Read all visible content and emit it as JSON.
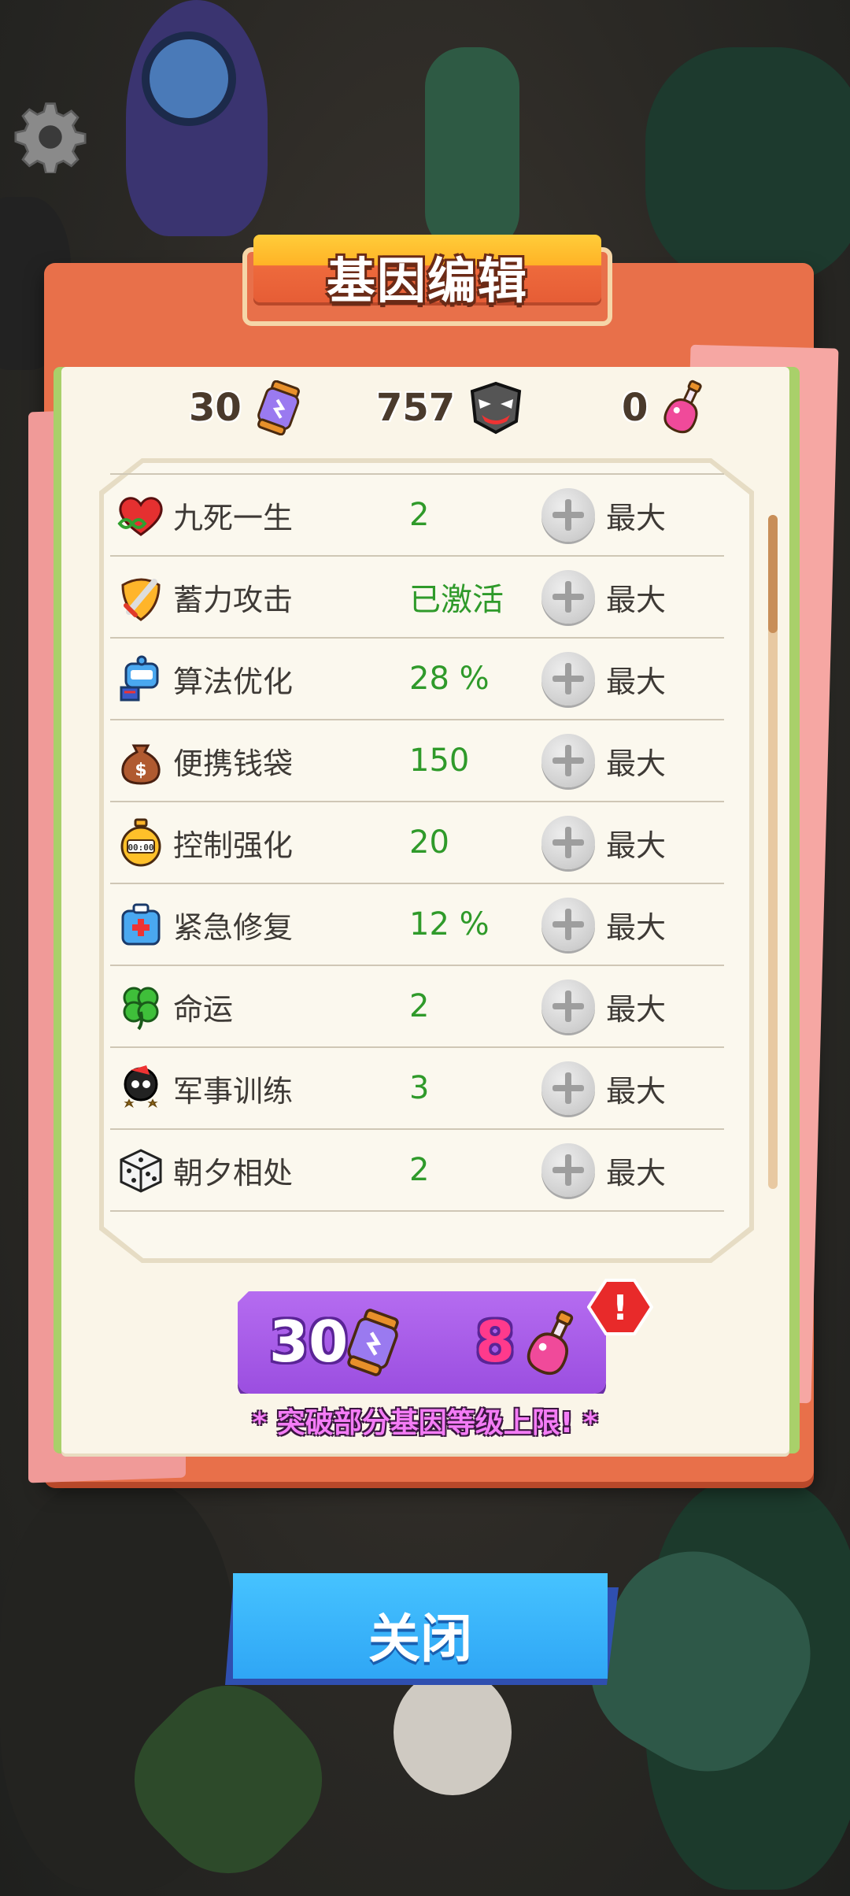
{
  "title": "基因编辑",
  "currencies": [
    {
      "value": "30",
      "icon": "gene-canister-icon"
    },
    {
      "value": "757",
      "icon": "boss-mask-icon"
    },
    {
      "value": "0",
      "icon": "pink-potion-icon"
    }
  ],
  "genes": [
    {
      "name": "九死一生",
      "value": "2",
      "max_label": "最大",
      "icon": "infinity-heart-icon"
    },
    {
      "name": "蓄力攻击",
      "value": "已激活",
      "max_label": "最大",
      "icon": "sword-shield-icon"
    },
    {
      "name": "算法优化",
      "value": "28 %",
      "max_label": "最大",
      "icon": "cpu-robot-icon"
    },
    {
      "name": "便携钱袋",
      "value": "150",
      "max_label": "最大",
      "icon": "money-bag-icon"
    },
    {
      "name": "控制强化",
      "value": "20",
      "max_label": "最大",
      "icon": "stopwatch-icon"
    },
    {
      "name": "紧急修复",
      "value": "12 %",
      "max_label": "最大",
      "icon": "first-aid-kit-icon"
    },
    {
      "name": "命运",
      "value": "2",
      "max_label": "最大",
      "icon": "four-leaf-clover-icon"
    },
    {
      "name": "军事训练",
      "value": "3",
      "max_label": "最大",
      "icon": "soldier-stars-icon"
    },
    {
      "name": "朝夕相处",
      "value": "2",
      "max_label": "最大",
      "icon": "dice-icon"
    }
  ],
  "breakthrough": {
    "cost_canister": "30",
    "cost_potion": "8",
    "alert": "!",
    "hint": "* 突破部分基因等级上限! *"
  },
  "close_label": "关闭",
  "colors": {
    "panel": "#e8704a",
    "value_green": "#2f9a2a",
    "breakthrough_purple": "#a75ce6",
    "close_blue": "#35b0fa"
  }
}
